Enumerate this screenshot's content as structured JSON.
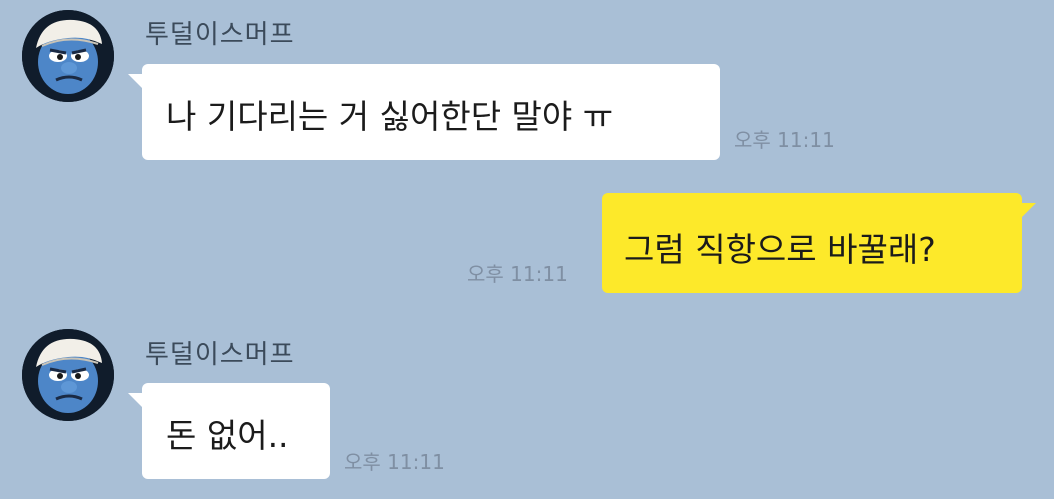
{
  "colors": {
    "background": "#a9bfd6",
    "incoming_bubble": "#ffffff",
    "outgoing_bubble": "#fde92a",
    "time_text": "#7f8fa3",
    "sender_text": "#3b4a5a"
  },
  "messages": [
    {
      "direction": "incoming",
      "sender": "투덜이스머프",
      "avatar_icon": "smurf-avatar-icon",
      "text": "나 기다리는 거 싫어한단 말야 ㅠ",
      "time": "오후 11:11"
    },
    {
      "direction": "outgoing",
      "text": "그럼 직항으로 바꿀래?",
      "time": "오후 11:11"
    },
    {
      "direction": "incoming",
      "sender": "투덜이스머프",
      "avatar_icon": "smurf-avatar-icon",
      "text": "돈 없어..",
      "time": "오후 11:11"
    }
  ]
}
